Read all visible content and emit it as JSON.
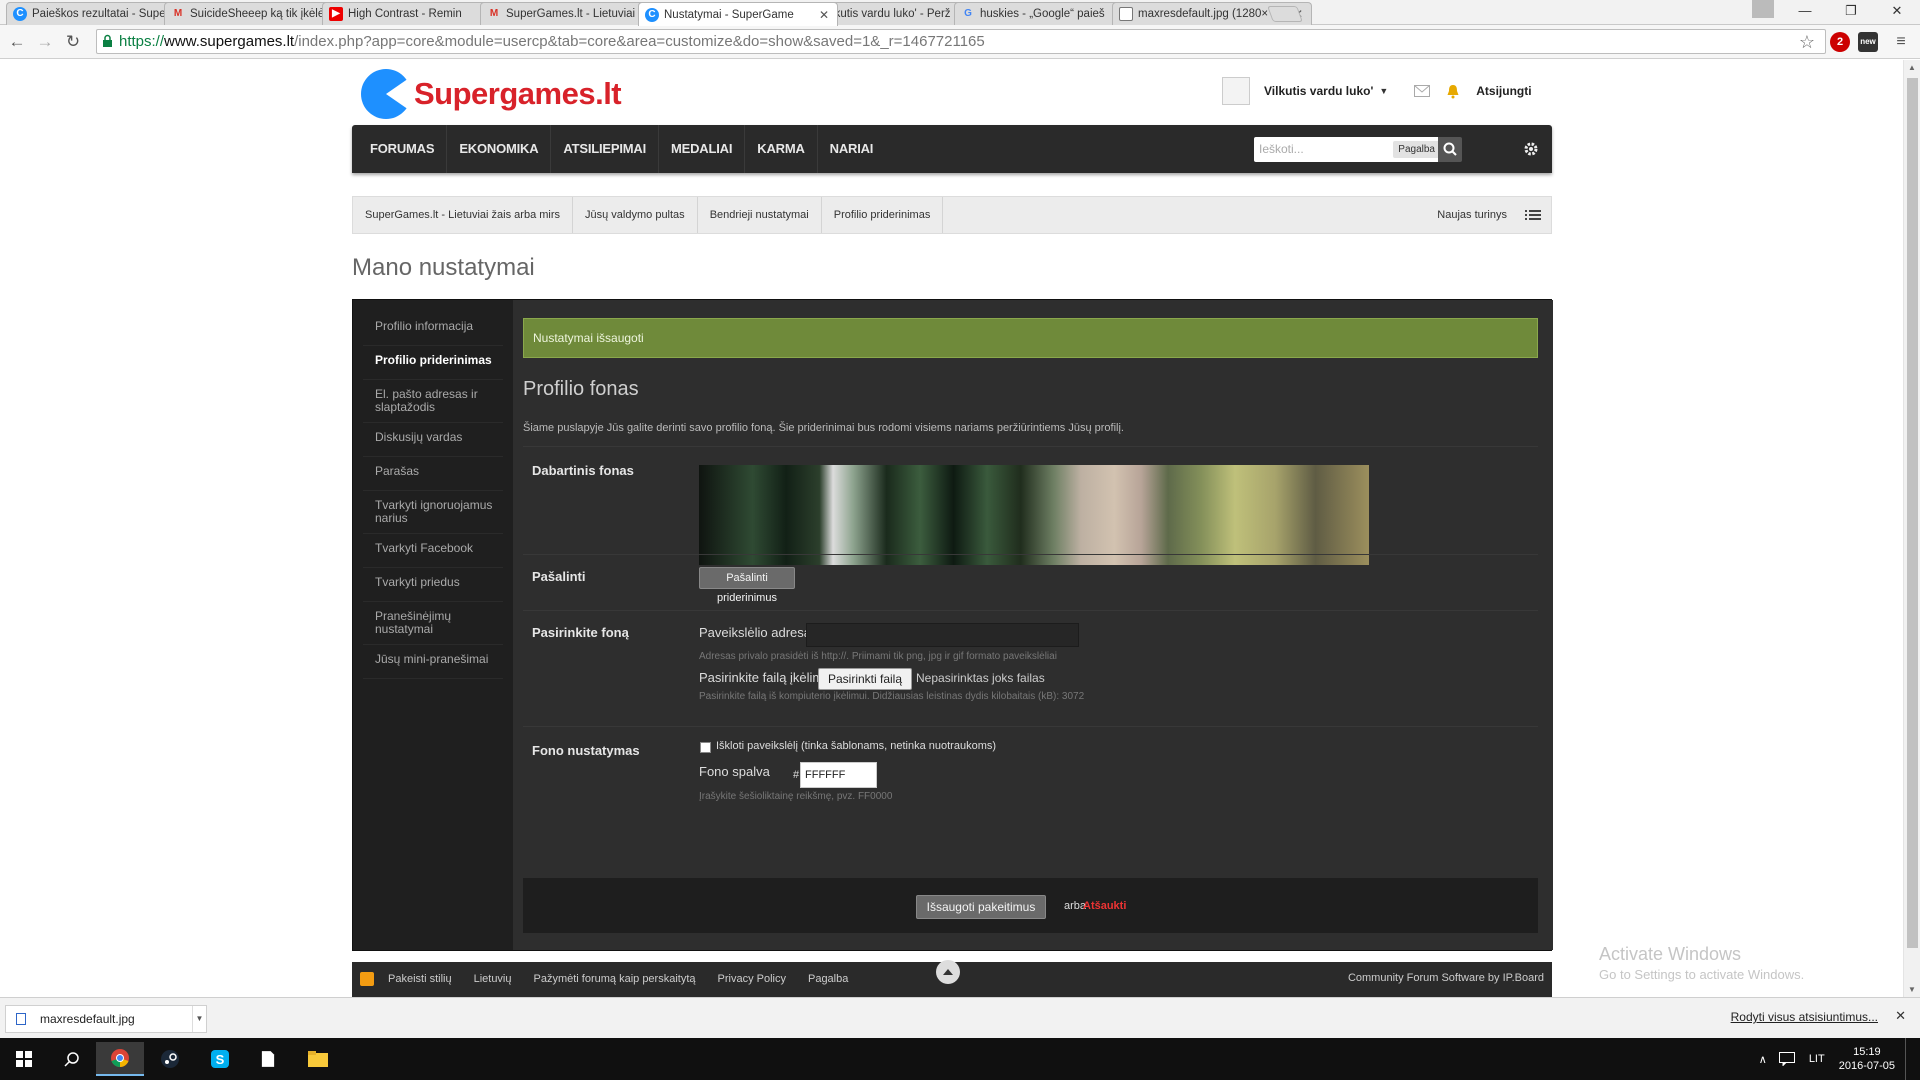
{
  "browser": {
    "tabs": [
      {
        "title": "Paieškos rezultatai - Supe",
        "icon": "supergames-favicon"
      },
      {
        "title": "SuicideSheeep ką tik įkėlė",
        "icon": "gmail-favicon"
      },
      {
        "title": "High Contrast - Remin",
        "icon": "youtube-favicon"
      },
      {
        "title": "SuperGames.lt - Lietuviai",
        "icon": "gmail-favicon"
      },
      {
        "title": "Nustatymai - SuperGame",
        "icon": "supergames-favicon"
      },
      {
        "title": "Vilkutis vardu luko' - Perž",
        "icon": "supergames-favicon"
      },
      {
        "title": "huskies - „Google“ paieš",
        "icon": "google-favicon"
      },
      {
        "title": "maxresdefault.jpg (1280×",
        "icon": "document-favicon"
      }
    ],
    "active_tab": 4,
    "url_scheme": "https://",
    "url_host": "www.supergames.lt",
    "url_path": "/index.php?app=core&module=usercp&tab=core&area=customize&do=show&saved=1&_r=1467721165",
    "extension_badge": "2",
    "extension_mail_badge": "new"
  },
  "site": {
    "logo_text": "Supergames.lt",
    "username": "Vilkutis vardu luko'",
    "logout": "Atsijungti",
    "nav": [
      "FORUMAS",
      "EKONOMIKA",
      "ATSILIEPIMAI",
      "MEDALIAI",
      "KARMA",
      "NARIAI"
    ],
    "search_placeholder": "Ieškoti...",
    "search_help": "Pagalba",
    "breadcrumb": [
      "SuperGames.lt - Lietuviai žais arba mirs",
      "Jūsų valdymo pultas",
      "Bendrieji nustatymai",
      "Profilio priderinimas"
    ],
    "new_content": "Naujas turinys",
    "page_title": "Mano nustatymai"
  },
  "sidebar": {
    "items": [
      "Profilio informacija",
      "Profilio priderinimas",
      "El. pašto adresas ir slaptažodis",
      "Diskusijų vardas",
      "Parašas",
      "Tvarkyti ignoruojamus narius",
      "Tvarkyti Facebook",
      "Tvarkyti priedus",
      "Pranešinėjimų nustatymai",
      "Jūsų mini-pranešimai"
    ],
    "active_index": 1
  },
  "form": {
    "success_message": "Nustatymai išsaugoti",
    "title": "Profilio fonas",
    "description": "Šiame puslapyje Jūs galite derinti savo profilio foną. Šie priderinimai bus rodomi visiems nariams peržiūrintiems Jūsų profilį.",
    "current_bg_label": "Dabartinis fonas",
    "remove_label": "Pašalinti",
    "remove_button": "Pašalinti priderinimus",
    "choose_bg_label": "Pasirinkite foną",
    "image_url_label": "Paveikslėlio adresas",
    "image_url_value": "",
    "image_url_hint": "Adresas privalo prasidėti iš http://. Priimami tik png, jpg ir gif formato paveikslėliai",
    "upload_label": "Pasirinkite failą įkėlimui",
    "upload_button": "Pasirinkti failą",
    "upload_status": "Nepasirinktas joks failas",
    "upload_hint": "Pasirinkite failą iš kompiuterio įkėlimui. Didžiausias leistinas dydis kilobaitais (kB): 3072",
    "bg_settings_label": "Fono nustatymas",
    "tile_checkbox_label": "Išklotі paveikslėlį (tinka šablonams, netinka nuotraukoms)",
    "tile_checked": false,
    "bg_color_label": "Fono spalva",
    "hash": "#",
    "bg_color_value": "FFFFFF",
    "bg_color_hint": "Įrašykite šešioliktainę reikšmę, pvz. FF0000",
    "save_button": "Išsaugoti pakeitimus",
    "or_text": "arba",
    "cancel_link": "Atšaukti"
  },
  "footer": {
    "links": [
      "Pakeisti stilių",
      "Lietuvių",
      "Pažymėti forumą kaip perskaitytą",
      "Privacy Policy",
      "Pagalba"
    ],
    "credit": "Community Forum Software by IP.Board"
  },
  "watermark": {
    "title": "Activate Windows",
    "subtitle": "Go to Settings to activate Windows."
  },
  "downloads": {
    "file": "maxresdefault.jpg",
    "show_all": "Rodyti visus atsisiuntimus..."
  },
  "taskbar": {
    "language": "LIT",
    "time": "15:19",
    "date": "2016-07-05"
  },
  "colors": {
    "brand_red": "#d8222a",
    "brand_blue": "#1e90ff",
    "success_green": "#6f8a3a",
    "nav_dark": "#2a2a2a"
  }
}
